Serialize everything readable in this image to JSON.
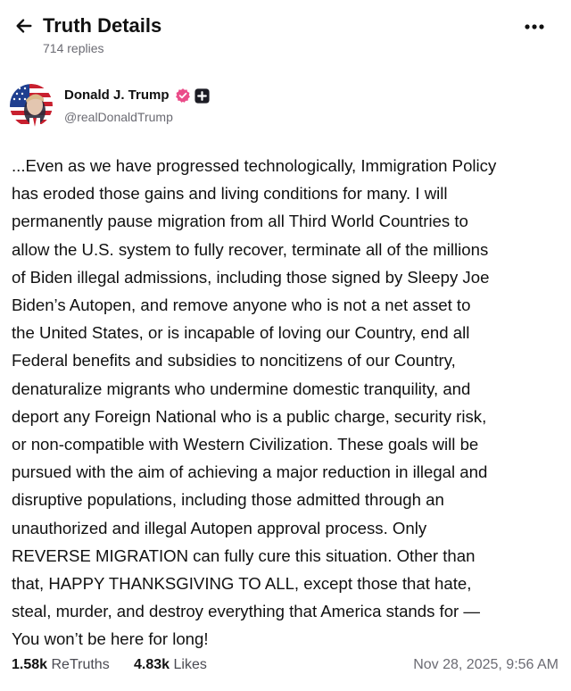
{
  "header": {
    "title": "Truth Details",
    "replies": "714 replies",
    "back_icon": "arrow-left-icon",
    "more_icon": "more-horizontal-icon"
  },
  "author": {
    "name": "Donald J. Trump",
    "handle": "@realDonaldTrump",
    "verified_color": "#ea4c89",
    "avatar_icon": "user-avatar"
  },
  "post": {
    "lines": [
      "...Even as we have progressed technologically, Immigration Policy",
      "has eroded those gains and living conditions for many. I will",
      "permanently pause migration from all Third World Countries to",
      "allow the U.S. system to fully recover, terminate all of the millions",
      "of Biden illegal admissions, including those signed by Sleepy Joe",
      "Biden’s Autopen, and remove anyone who is not a net asset to",
      "the United States, or is incapable of loving our Country, end all",
      "Federal benefits and subsidies to noncitizens of our Country,",
      "denaturalize migrants who undermine domestic tranquility, and",
      "deport any Foreign National who is a public charge, security risk,",
      "or non-compatible with Western Civilization. These goals will be",
      "pursued with the aim of achieving a major reduction in illegal and",
      "disruptive populations, including those admitted through an",
      "unauthorized and illegal Autopen approval process. Only",
      "REVERSE MIGRATION can fully cure this situation. Other than",
      "that, HAPPY THANKSGIVING TO ALL, except those that hate,",
      "steal, murder, and destroy everything that America stands for —",
      "You won’t be here for long!"
    ]
  },
  "stats": {
    "retruths_count": "1.58k",
    "retruths_label": "ReTruths",
    "likes_count": "4.83k",
    "likes_label": "Likes",
    "timestamp": "Nov 28, 2025, 9:56 AM"
  }
}
